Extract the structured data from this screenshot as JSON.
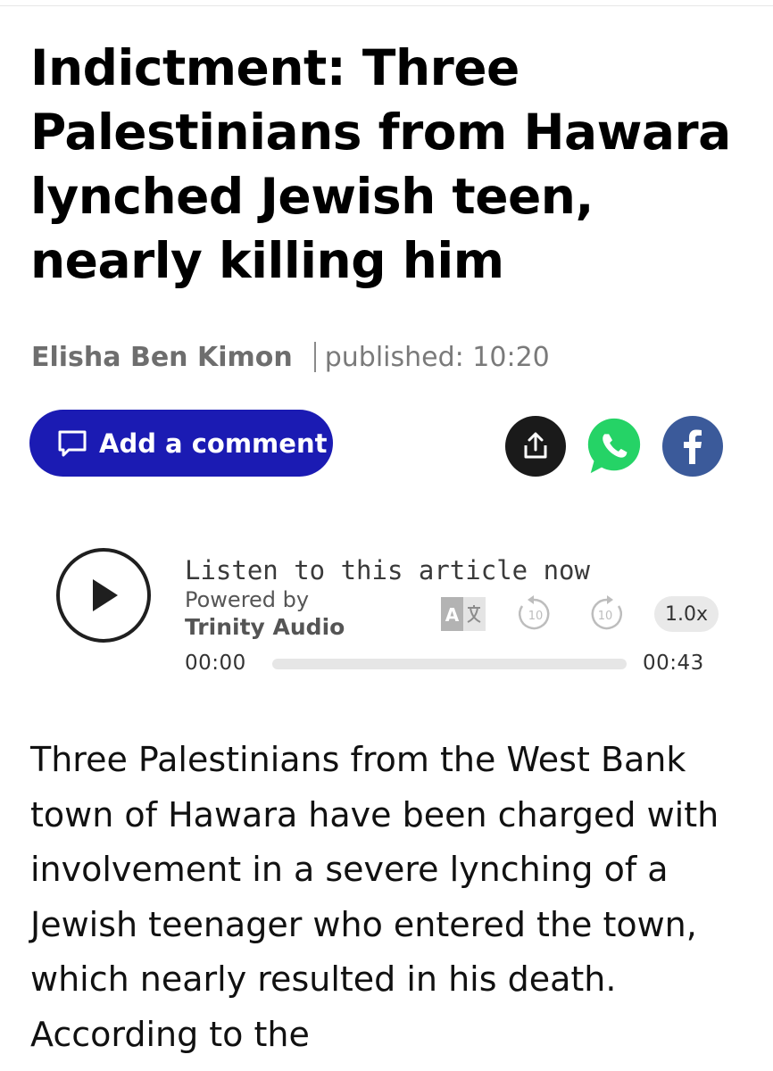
{
  "article": {
    "headline": "Indictment: Three Palestinians from Hawara lynched Jewish teen, nearly killing him",
    "author": "Elisha Ben Kimon",
    "published_label": "published: 10:20",
    "body": "Three Palestinians from the West Bank town of Hawara have been charged with involvement in a severe lynching of a Jewish teenager who entered the town, which nearly resulted in his death. According to the"
  },
  "actions": {
    "comment_label": "Add a comment",
    "share_icons": [
      "share-icon",
      "whatsapp-icon",
      "facebook-icon"
    ]
  },
  "player": {
    "title": "Listen to this article now",
    "powered_by": "Powered by",
    "provider": "Trinity Audio",
    "translate_icon": "A文",
    "rewind_seconds": "10",
    "forward_seconds": "10",
    "speed": "1.0x",
    "current_time": "00:00",
    "total_time": "00:43",
    "progress_fraction": 0
  },
  "colors": {
    "comment_button": "#1b1bb3",
    "whatsapp": "#25d366",
    "facebook": "#3b5a9a",
    "share": "#1a1a1a"
  }
}
